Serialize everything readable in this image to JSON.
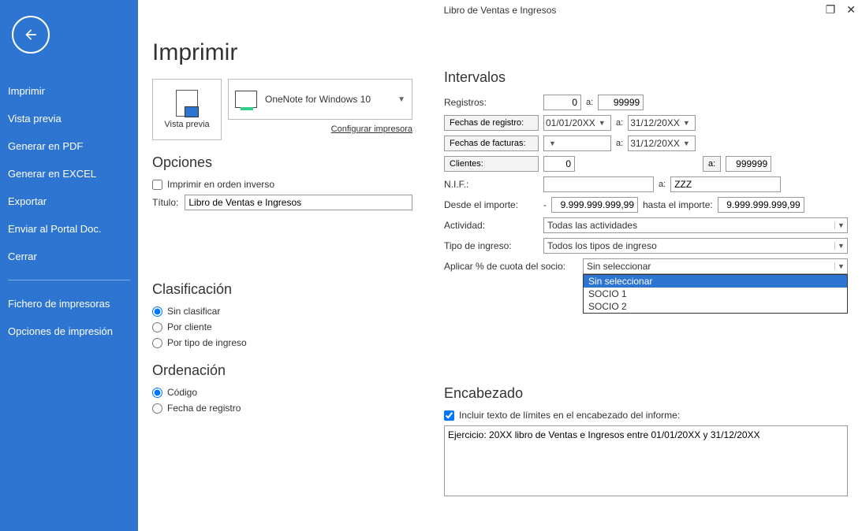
{
  "window_title": "Libro de Ventas e Ingresos",
  "sidebar": {
    "items": [
      "Imprimir",
      "Vista previa",
      "Generar en PDF",
      "Generar en EXCEL",
      "Exportar",
      "Enviar al Portal Doc.",
      "Cerrar"
    ],
    "items2": [
      "Fichero de impresoras",
      "Opciones de impresión"
    ]
  },
  "main": {
    "title": "Imprimir",
    "preview_label": "Vista previa",
    "printer_name": "OneNote for Windows 10",
    "configure_printer": "Configurar impresora",
    "options_heading": "Opciones",
    "reverse_label": "Imprimir en orden inverso",
    "title_label": "Título:",
    "title_value": "Libro de Ventas e Ingresos",
    "class_heading": "Clasificación",
    "class_options": [
      "Sin clasificar",
      "Por cliente",
      "Por tipo de ingreso"
    ],
    "order_heading": "Ordenación",
    "order_options": [
      "Código",
      "Fecha de registro"
    ]
  },
  "intervals": {
    "heading": "Intervalos",
    "registros_label": "Registros:",
    "registros_from": "0",
    "registros_to": "99999",
    "fechas_reg_btn": "Fechas de registro:",
    "fecha_reg_from": "01/01/20XX",
    "fecha_reg_to": "31/12/20XX",
    "fechas_fac_btn": "Fechas de facturas:",
    "fecha_fac_from": "",
    "fecha_fac_to": "31/12/20XX",
    "clientes_btn": "Clientes:",
    "clientes_from": "0",
    "clientes_to": "999999",
    "nif_label": "N.I.F.:",
    "nif_from": "",
    "nif_to": "ZZZ",
    "importe_from_label": "Desde el importe:",
    "importe_from": "9.999.999.999,99",
    "importe_from_sign": "-",
    "importe_to_label": "hasta el importe:",
    "importe_to": "9.999.999.999,99",
    "actividad_label": "Actividad:",
    "actividad_value": "Todas las actividades",
    "tipo_label": "Tipo de ingreso:",
    "tipo_value": "Todos los tipos de ingreso",
    "cuota_label": "Aplicar % de cuota del socio:",
    "cuota_value": "Sin seleccionar",
    "cuota_options": [
      "Sin seleccionar",
      "SOCIO 1",
      "SOCIO 2"
    ],
    "a": "a:"
  },
  "header_section": {
    "heading": "Encabezado",
    "include_label": "Incluir texto de límites en el encabezado del informe:",
    "textarea_value": "Ejercicio: 20XX libro de Ventas e Ingresos entre 01/01/20XX y 31/12/20XX"
  }
}
